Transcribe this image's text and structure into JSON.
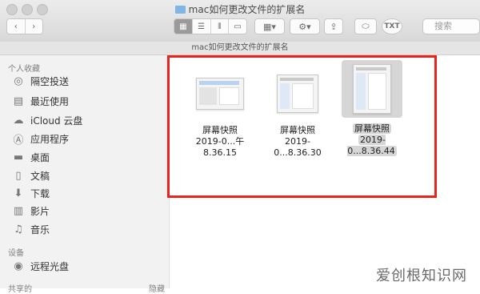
{
  "window": {
    "title": "mac如何更改文件的扩展名",
    "path_title": "mac如何更改文件的扩展名"
  },
  "toolbar": {
    "tag_label": "TXT",
    "search_placeholder": "搜索"
  },
  "sidebar": {
    "sections": [
      {
        "title": "个人收藏"
      },
      {
        "title": "设备"
      }
    ],
    "items": [
      {
        "label": "隔空投送",
        "icon": "airdrop-icon"
      },
      {
        "label": "最近使用",
        "icon": "recents-icon"
      },
      {
        "label": "iCloud 云盘",
        "icon": "icloud-icon"
      },
      {
        "label": "应用程序",
        "icon": "applications-icon"
      },
      {
        "label": "桌面",
        "icon": "desktop-icon"
      },
      {
        "label": "文稿",
        "icon": "documents-icon"
      },
      {
        "label": "下载",
        "icon": "downloads-icon"
      },
      {
        "label": "影片",
        "icon": "movies-icon"
      },
      {
        "label": "音乐",
        "icon": "music-icon"
      },
      {
        "label": "远程光盘",
        "icon": "remote-disc-icon"
      }
    ],
    "bottom_left": "共享的",
    "bottom_right": "隐藏"
  },
  "files": [
    {
      "name": "屏幕快照",
      "date": "2019-0...午8.36.15",
      "selected": false
    },
    {
      "name": "屏幕快照",
      "date": "2019-0...8.36.30",
      "selected": false
    },
    {
      "name": "屏幕快照",
      "date": "2019-0...8.36.44",
      "selected": true
    }
  ],
  "watermark": "爱创根知识网",
  "highlight_color": "#e8251c"
}
